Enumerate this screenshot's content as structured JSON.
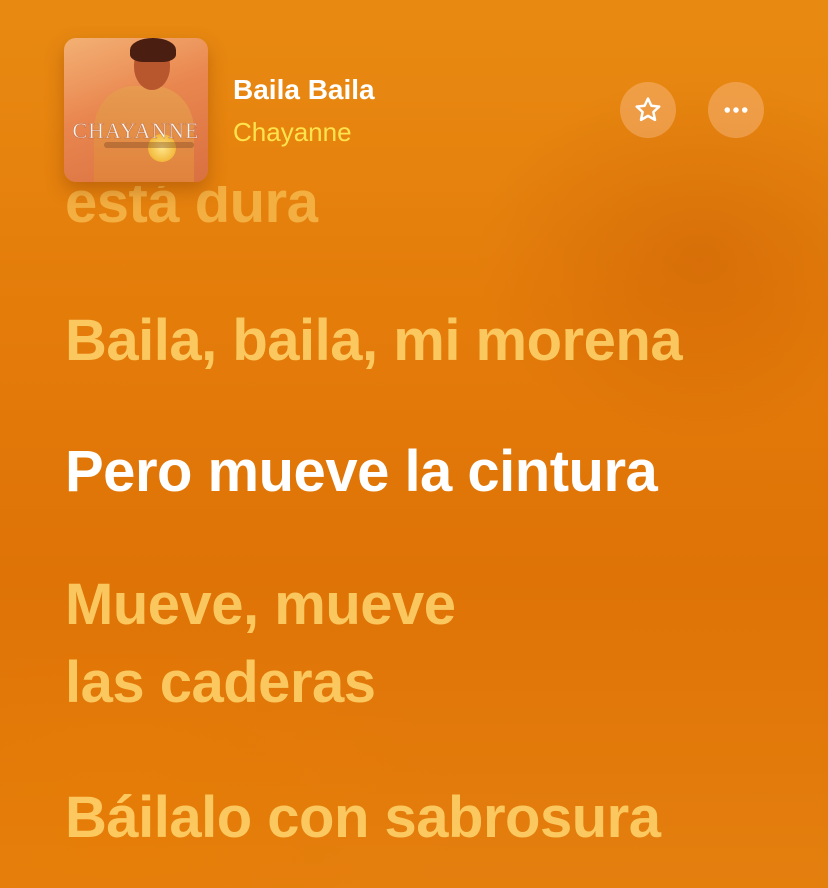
{
  "now_playing": {
    "title": "Baila Baila",
    "artist": "Chayanne",
    "album_art_text": "CHAYANNE"
  },
  "controls": {
    "favorite_icon": "star-icon",
    "more_icon": "ellipsis-icon"
  },
  "lyrics": {
    "lines": [
      "está dura",
      "Baila, baila, mi morena",
      "Pero mueve la cintura",
      "Mueve, mueve",
      "las caderas",
      "Báilalo con sabrosura"
    ],
    "active_index": 2
  },
  "colors": {
    "background": "#e47c0a",
    "artist_text": "#ffe34d",
    "active_lyric": "#ffffff",
    "inactive_lyric": "#ffd66e"
  }
}
